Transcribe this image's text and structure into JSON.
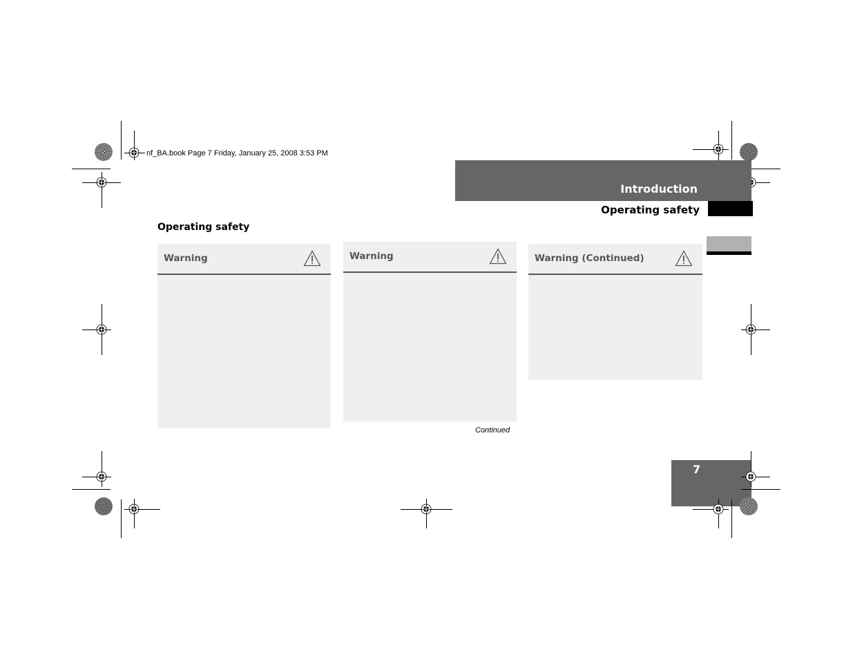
{
  "print_info": "nf_BA.book  Page 7  Friday, January 25, 2008  3:53 PM",
  "header": {
    "chapter": "Introduction",
    "section": "Operating safety"
  },
  "page_heading": "Operating safety",
  "warnings": [
    {
      "label": "Warning",
      "icon": "warning-triangle-icon"
    },
    {
      "label": "Warning",
      "icon": "warning-triangle-icon"
    },
    {
      "label": "Warning (Continued)",
      "icon": "warning-triangle-icon"
    }
  ],
  "continued_label": "Continued",
  "page_number": "7",
  "colors": {
    "band": "#666666",
    "box_background": "#efefef",
    "box_rule": "#555555",
    "tab_grey": "#b1b1b1"
  }
}
